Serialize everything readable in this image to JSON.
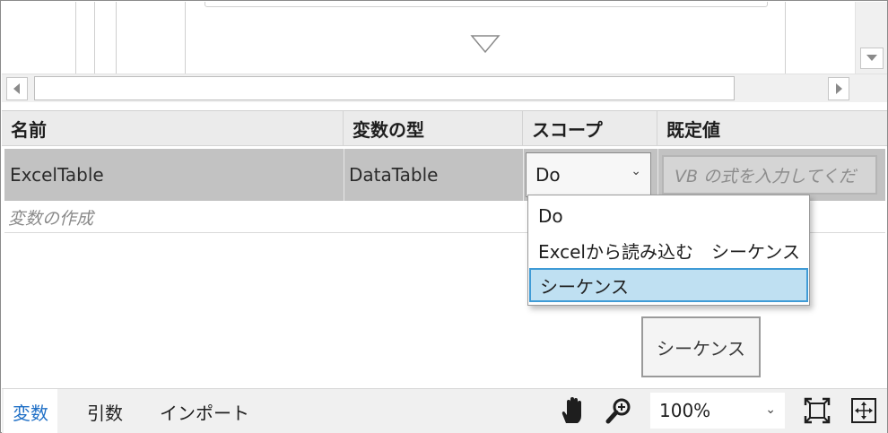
{
  "grid": {
    "columns": [
      "名前",
      "変数の型",
      "スコープ",
      "既定値"
    ],
    "rows": [
      {
        "name": "ExcelTable",
        "type": "DataTable",
        "scope": "Do",
        "default_placeholder": "VB の式を入力してくだ"
      }
    ],
    "create_variable": "変数の作成"
  },
  "scope_dropdown": {
    "options": [
      "Do",
      "Excelから読み込む　シーケンス",
      "シーケンス"
    ],
    "selected": "シーケンス"
  },
  "canvas": {
    "sequence_label": "シーケンス"
  },
  "bottom_bar": {
    "tabs": [
      "変数",
      "引数",
      "インポート"
    ],
    "active_tab": "変数",
    "zoom": "100%"
  },
  "icons": {
    "pan": "hand-icon",
    "zoom": "magnifier-icon",
    "fit": "fit-to-screen-icon",
    "overview": "overview-icon"
  },
  "colors": {
    "active_tab": "#1f6fc6",
    "selected_option_bg": "#bfe0f2",
    "selected_option_border": "#3f9bd6",
    "row_selected_bg": "#c2c2c2"
  }
}
